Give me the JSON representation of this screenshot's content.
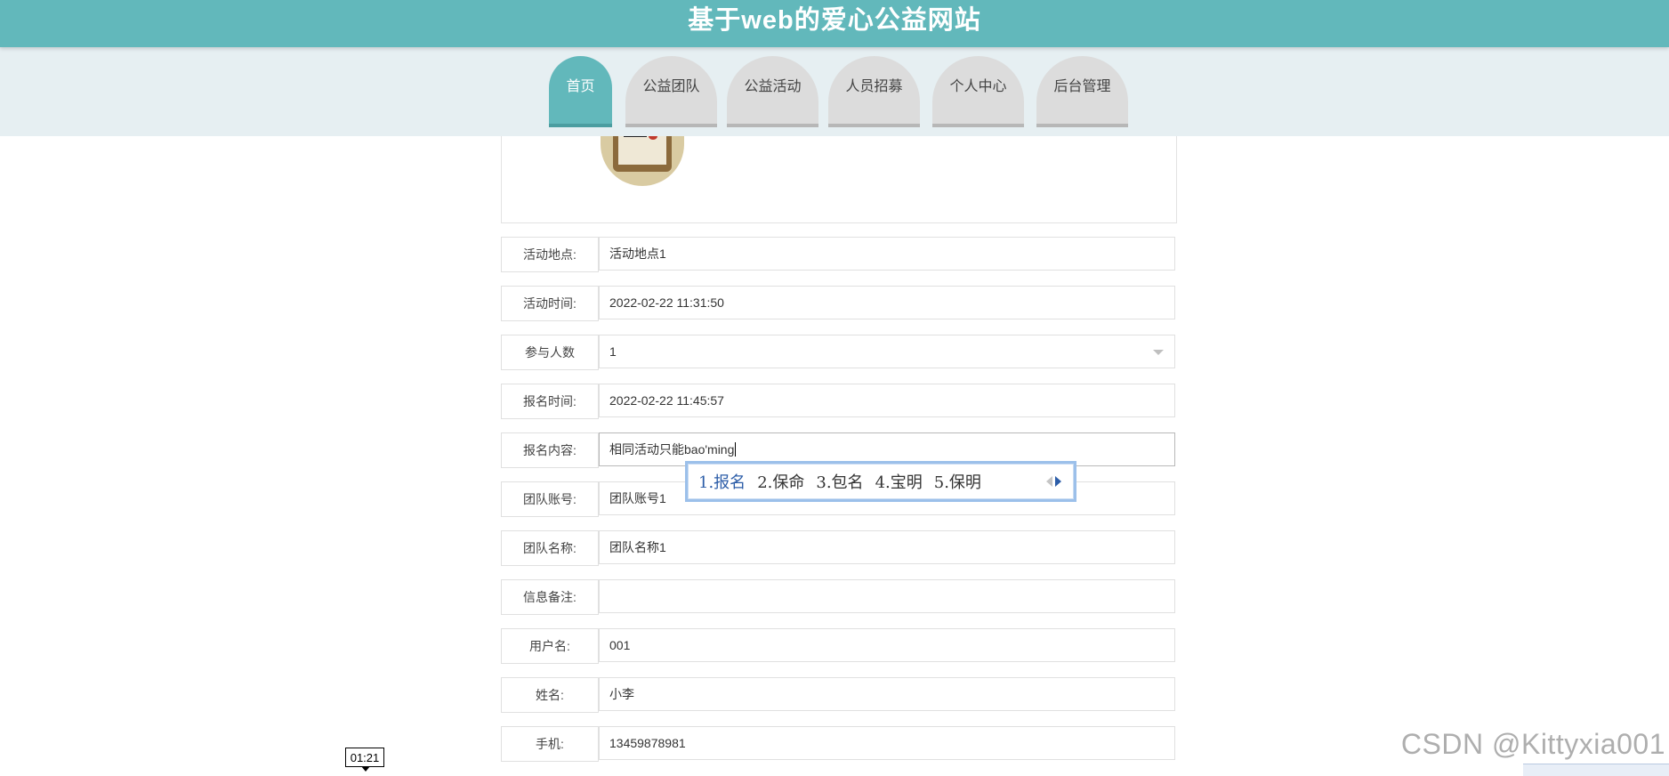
{
  "header": {
    "title": "基于web的爱心公益网站"
  },
  "nav": {
    "tabs": [
      {
        "label": "首页",
        "active": true
      },
      {
        "label": "公益团队",
        "active": false
      },
      {
        "label": "公益活动",
        "active": false
      },
      {
        "label": "人员招募",
        "active": false
      },
      {
        "label": "个人中心",
        "active": false
      },
      {
        "label": "后台管理",
        "active": false
      }
    ]
  },
  "form": {
    "fields": [
      {
        "label": "活动地点:",
        "value": "活动地点1"
      },
      {
        "label": "活动时间:",
        "value": "2022-02-22 11:31:50"
      },
      {
        "label": "参与人数",
        "value": "1",
        "type": "select"
      },
      {
        "label": "报名时间:",
        "value": "2022-02-22 11:45:57"
      },
      {
        "label": "报名内容:",
        "value": "相同活动只能bao'ming",
        "focused": true
      },
      {
        "label": "团队账号:",
        "value": "团队账号1"
      },
      {
        "label": "团队名称:",
        "value": "团队名称1"
      },
      {
        "label": "信息备注:",
        "value": ""
      },
      {
        "label": "用户名:",
        "value": "001"
      },
      {
        "label": "姓名:",
        "value": "小李"
      },
      {
        "label": "手机:",
        "value": "13459878981"
      }
    ]
  },
  "ime": {
    "candidates": [
      "1.报名",
      "2.保命",
      "3.包名",
      "4.宝明",
      "5.保明"
    ]
  },
  "overlay": {
    "timer": "01:21",
    "watermark": "CSDN @Kittyxia001"
  },
  "colors": {
    "accent": "#62b8bb",
    "nav_background": "#e6eff2",
    "inactive_tab": "#dcdcdc"
  }
}
